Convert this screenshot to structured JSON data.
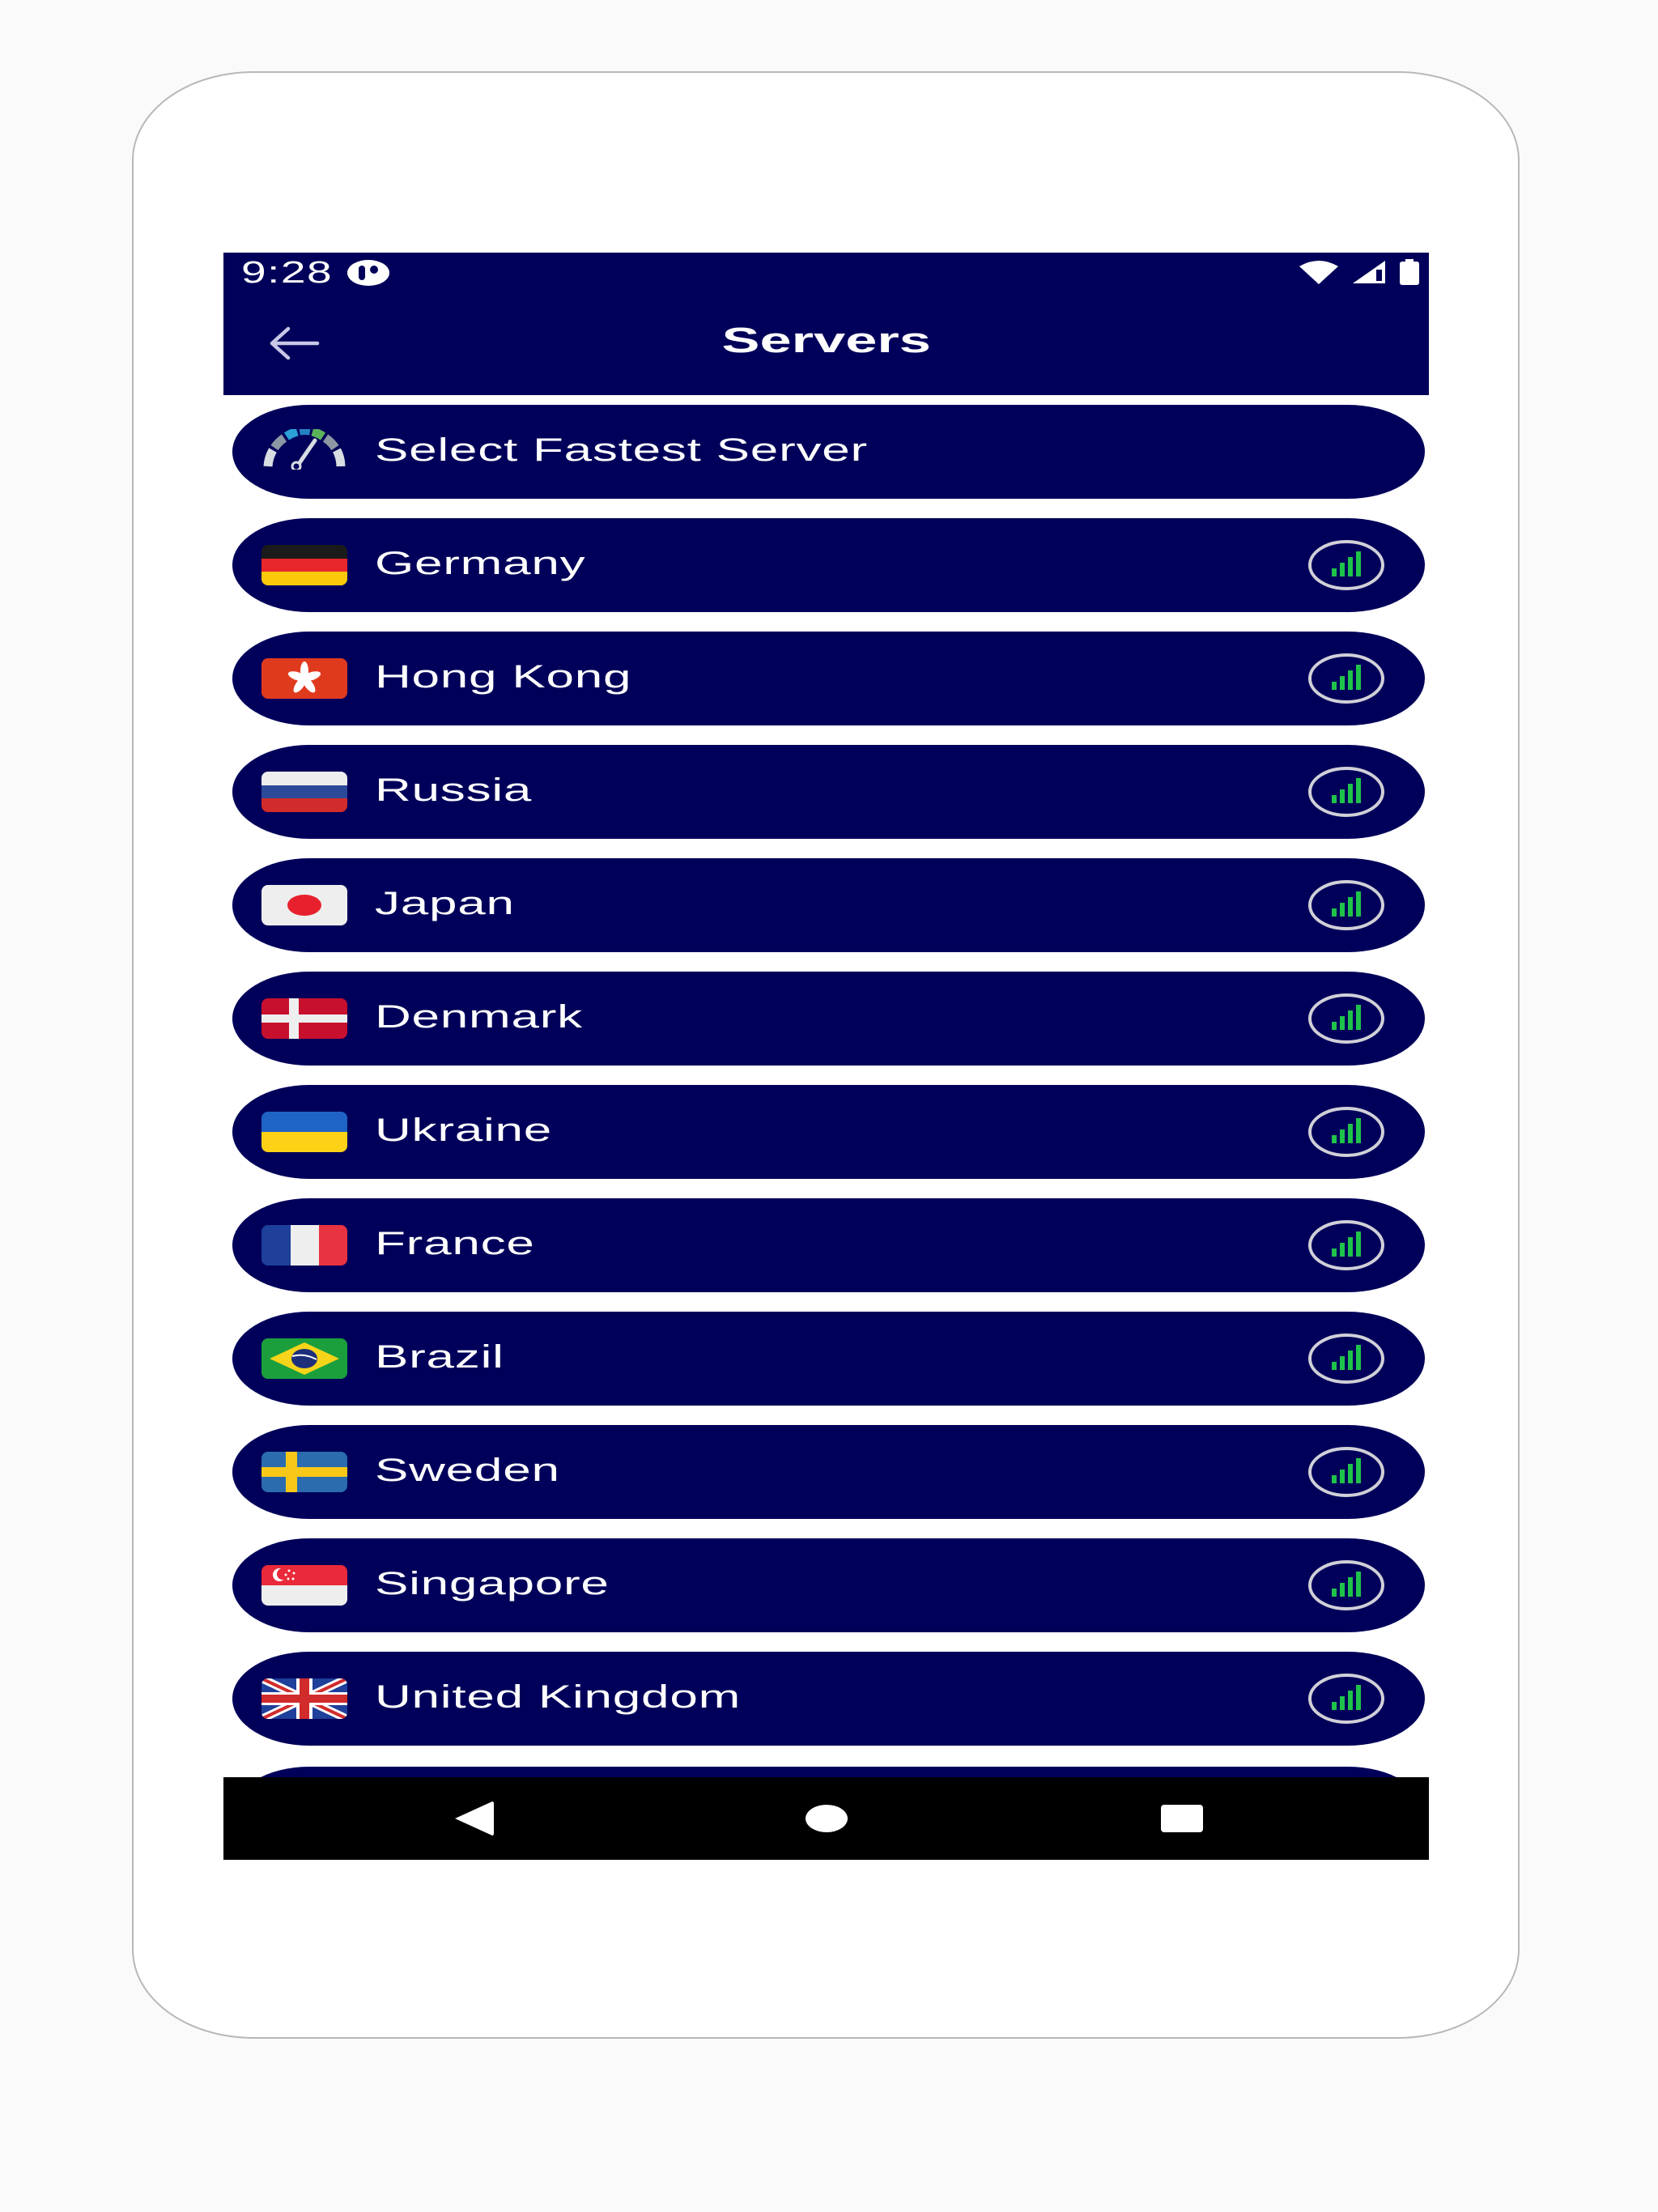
{
  "status_bar": {
    "time": "9:28",
    "icons": [
      "app-notification-icon",
      "wifi-icon",
      "cellular-signal-icon",
      "battery-icon"
    ]
  },
  "toolbar": {
    "title": "Servers",
    "back_icon": "arrow-left-icon"
  },
  "servers": {
    "fastest": {
      "label": "Select Fastest Server",
      "icon": "speedometer-icon"
    },
    "items": [
      {
        "name": "Germany",
        "flag": "flag-germany",
        "signal_bars": 4
      },
      {
        "name": "Hong Kong",
        "flag": "flag-hong-kong",
        "signal_bars": 4
      },
      {
        "name": "Russia",
        "flag": "flag-russia",
        "signal_bars": 4
      },
      {
        "name": "Japan",
        "flag": "flag-japan",
        "signal_bars": 4
      },
      {
        "name": "Denmark",
        "flag": "flag-denmark",
        "signal_bars": 4
      },
      {
        "name": "Ukraine",
        "flag": "flag-ukraine",
        "signal_bars": 4
      },
      {
        "name": "France",
        "flag": "flag-france",
        "signal_bars": 4
      },
      {
        "name": "Brazil",
        "flag": "flag-brazil",
        "signal_bars": 4
      },
      {
        "name": "Sweden",
        "flag": "flag-sweden",
        "signal_bars": 4
      },
      {
        "name": "Singapore",
        "flag": "flag-singapore",
        "signal_bars": 4
      },
      {
        "name": "United Kingdom",
        "flag": "flag-united-kingdom",
        "signal_bars": 4
      }
    ]
  },
  "nav_bar": {
    "buttons": [
      "back-triangle-icon",
      "home-circle-icon",
      "recents-square-icon"
    ]
  },
  "colors": {
    "primary": "#00005a",
    "signal": "#1fc24a",
    "page_background": "#fafafa",
    "nav_bar": "#000000"
  }
}
